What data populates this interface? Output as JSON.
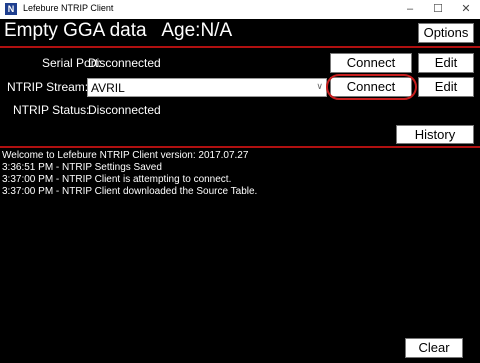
{
  "window": {
    "title": "Lefebure NTRIP Client",
    "icon_letter": "N",
    "controls": {
      "minimize": "–",
      "maximize": "☐",
      "close": "✕"
    }
  },
  "header": {
    "status": "Empty GGA data   Age:N/A",
    "options_label": "Options"
  },
  "serial": {
    "label": "Serial Port:",
    "value": "Disconnected",
    "connect_label": "Connect",
    "edit_label": "Edit"
  },
  "stream": {
    "label": "NTRIP Stream:",
    "selected": "AVRIL",
    "connect_label": "Connect",
    "edit_label": "Edit"
  },
  "ntrip_status": {
    "label": "NTRIP Status:",
    "value": "Disconnected"
  },
  "history_label": "History",
  "log": [
    "Welcome to Lefebure NTRIP Client version: 2017.07.27",
    "3:36:51 PM - NTRIP Settings Saved",
    "3:37:00 PM - NTRIP Client is attempting to connect.",
    "3:37:00 PM - NTRIP Client downloaded the Source Table."
  ],
  "clear_label": "Clear",
  "colors": {
    "background": "#000000",
    "accent_line": "#b01010",
    "highlight_ring": "#c81e1e"
  }
}
